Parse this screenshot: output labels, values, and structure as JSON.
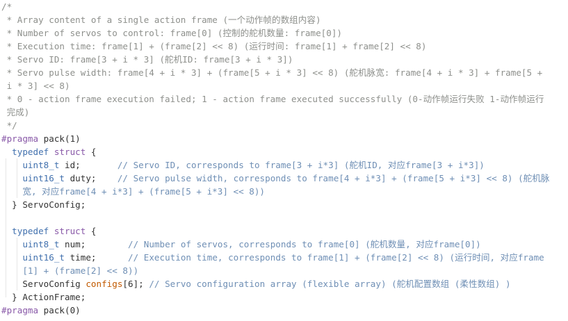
{
  "colors": {
    "comment": "#8e908c",
    "keyword": "#8959a8",
    "type": "#4271ae",
    "code_comment": "#6f8fb5",
    "highlight": "#c25a00",
    "text": "#333333",
    "background": "#ffffff"
  },
  "doc_comment": {
    "open": "/*",
    "lines": [
      " * Array content of a single action frame (一个动作帧的数组内容)",
      " * Number of servos to control: frame[0] (控制的舵机数量: frame[0])",
      " * Execution time: frame[1] + (frame[2] << 8) (运行时间: frame[1] + frame[2] << 8)",
      " * Servo ID: frame[3 + i * 3] (舵机ID: frame[3 + i * 3])",
      " * Servo pulse width: frame[4 + i * 3] + (frame[5 + i * 3] << 8) (舵机脉宽: frame[4 + i * 3] + frame[5 +",
      " i * 3] << 8)",
      " * 0 - action frame execution failed; 1 - action frame executed successfully (0-动作帧运行失败 1-动作帧运行",
      " 完成)"
    ],
    "close": " */"
  },
  "pragma1": {
    "directive": "#pragma",
    "rest": " pack(1)"
  },
  "servo_config": {
    "typedef": "typedef",
    "struct": "struct",
    "open": " {",
    "field1": {
      "type": "uint8_t",
      "decl": " id;       ",
      "comment": "// Servo ID, corresponds to frame[3 + i*3] (舵机ID, 对应frame[3 + i*3])"
    },
    "field2": {
      "type": "uint16_t",
      "decl": " duty;    ",
      "comment": "// Servo pulse width, corresponds to frame[4 + i*3] + (frame[5 + i*3] << 8) (舵机脉",
      "comment_cont": "宽, 对应frame[4 + i*3] + (frame[5 + i*3] << 8))"
    },
    "close": "} ServoConfig;"
  },
  "action_frame": {
    "typedef": "typedef",
    "struct": "struct",
    "open": " {",
    "field1": {
      "type": "uint8_t",
      "decl": " num;        ",
      "comment": "// Number of servos, corresponds to frame[0] (舵机数量, 对应frame[0])"
    },
    "field2": {
      "type": "uint16_t",
      "decl": " time;      ",
      "comment": "// Execution time, corresponds to frame[1] + (frame[2] << 8) (运行时间, 对应frame",
      "comment_cont": "[1] + (frame[2] << 8))"
    },
    "field3": {
      "type": "ServoConfig",
      "name": "configs",
      "rest": "[6]; ",
      "comment": "// Servo configuration array (flexible array) (舵机配置数组 (柔性数组) )"
    },
    "close": "} ActionFrame;"
  },
  "pragma0": {
    "directive": "#pragma",
    "rest": " pack(0)"
  }
}
